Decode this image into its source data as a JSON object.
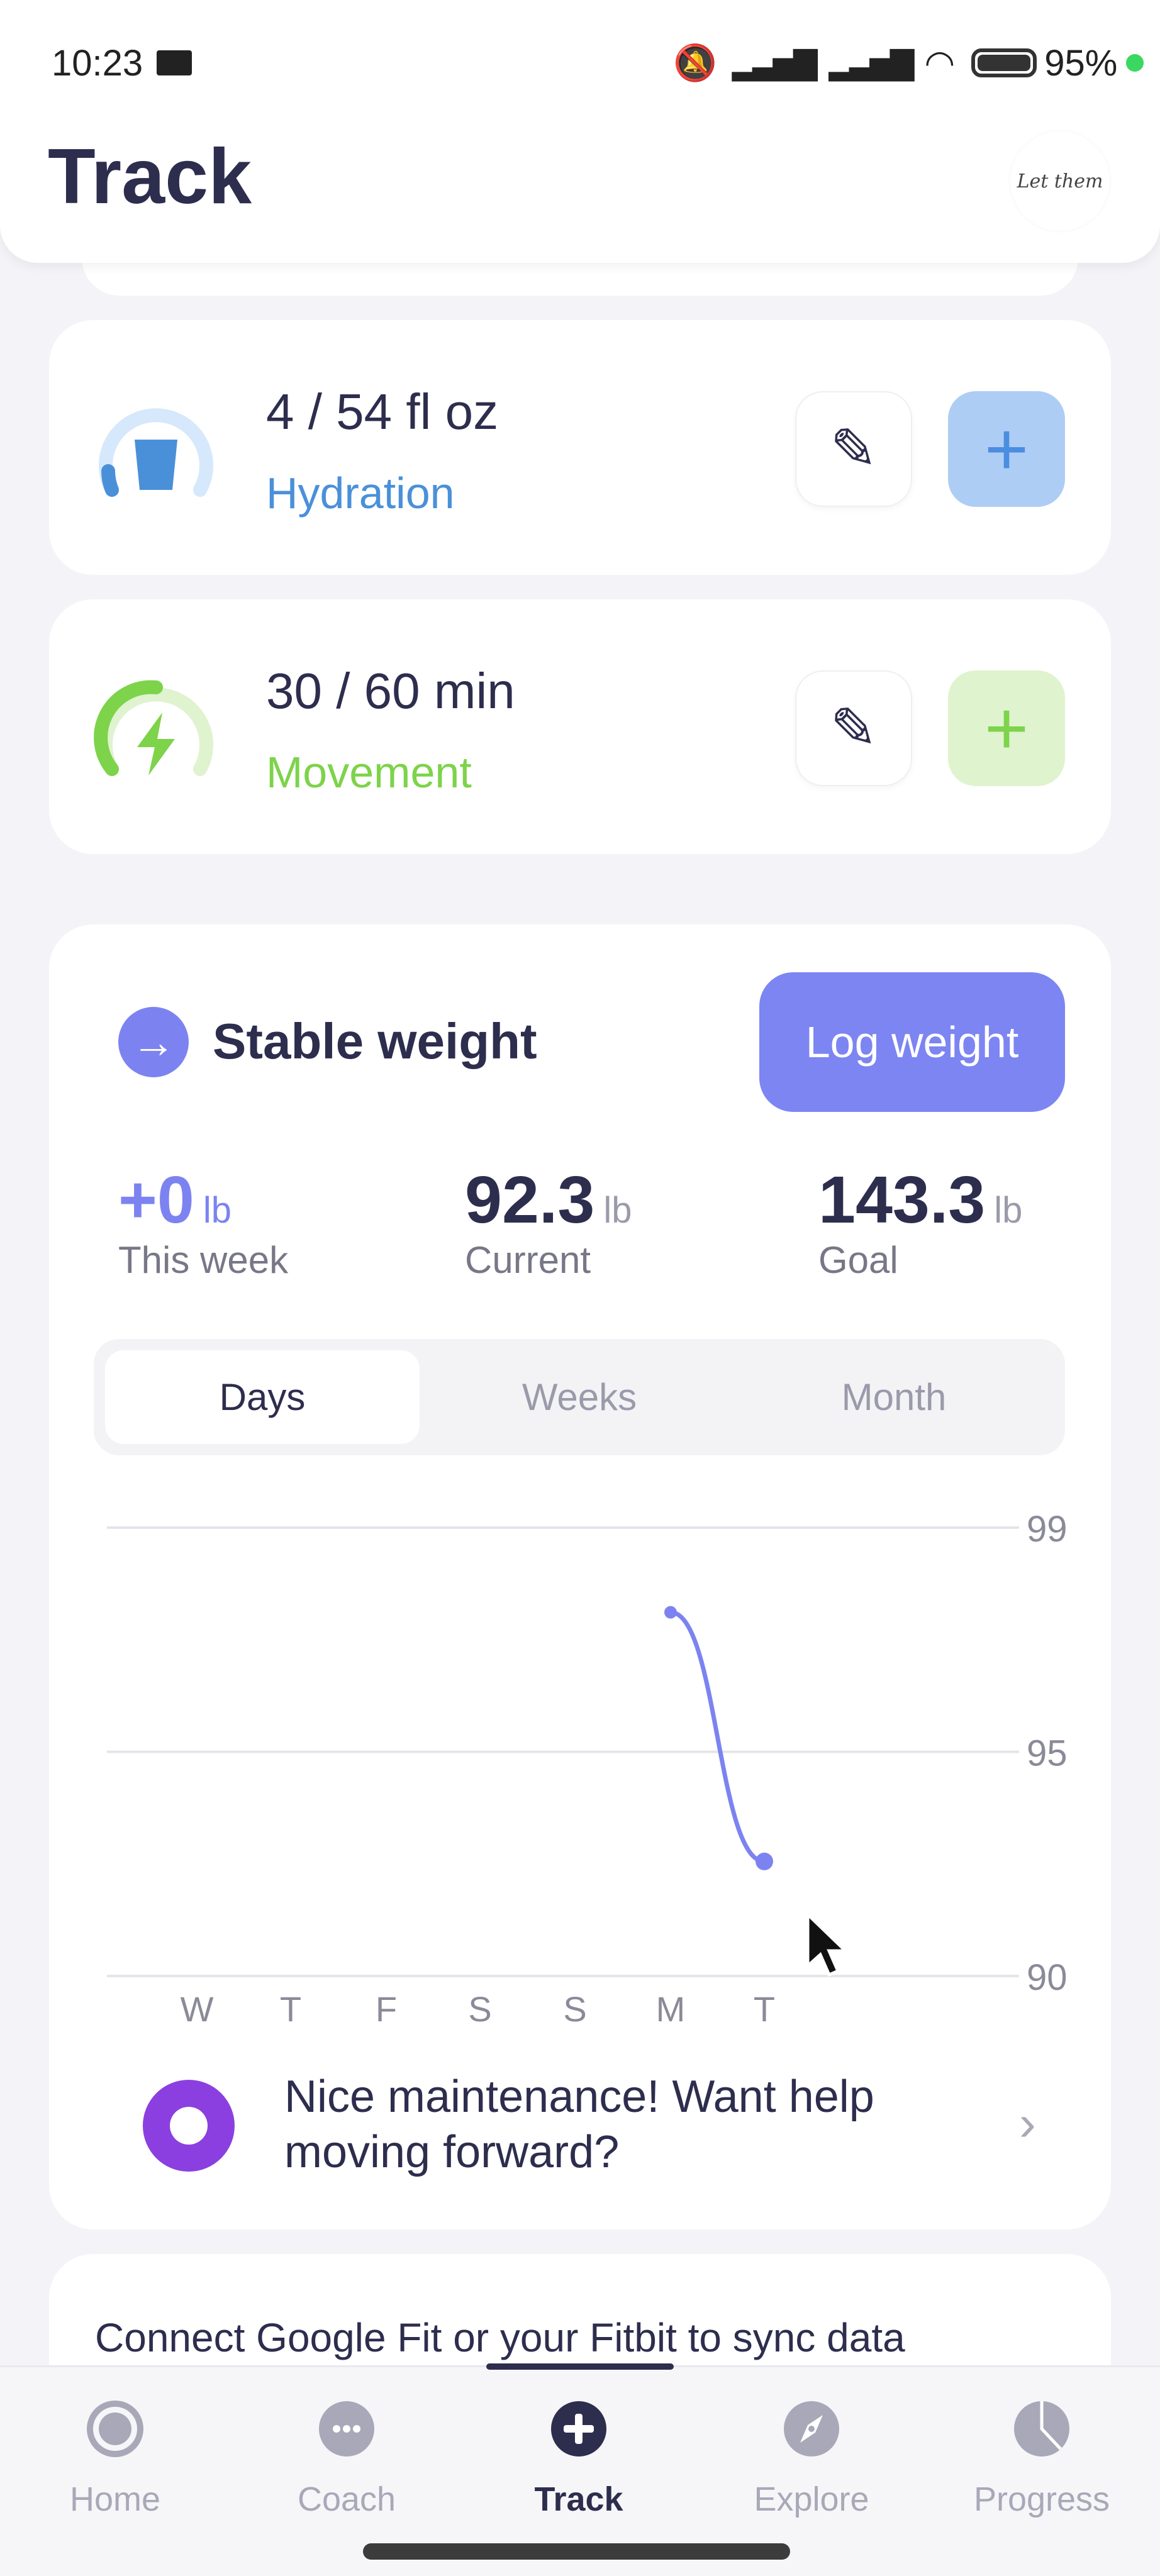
{
  "status_bar": {
    "time": "10:23",
    "battery": "95%"
  },
  "header": {
    "title": "Track",
    "avatar_text": "Let them"
  },
  "hydration": {
    "value": "4 / 54 fl oz",
    "label": "Hydration",
    "color": "#4a90d9"
  },
  "movement": {
    "value": "30 / 60 min",
    "label": "Movement",
    "color": "#7dd34a"
  },
  "weight": {
    "status": "Stable weight",
    "log_button": "Log weight",
    "stats": [
      {
        "value": "+0",
        "unit": "lb",
        "label": "This week"
      },
      {
        "value": "92.3",
        "unit": "lb",
        "label": "Current"
      },
      {
        "value": "143.3",
        "unit": "lb",
        "label": "Goal"
      }
    ],
    "tabs": [
      "Days",
      "Weeks",
      "Month"
    ],
    "selected_tab": "Days",
    "tip": {
      "line1": "Nice maintenance! Want help",
      "line2": "moving forward?"
    }
  },
  "chart_data": {
    "type": "line",
    "categories": [
      "W",
      "T",
      "F",
      "S",
      "S",
      "M",
      "T"
    ],
    "values": [
      null,
      null,
      null,
      null,
      null,
      97.3,
      92.3
    ],
    "ylim": [
      90,
      99
    ],
    "ytick_labels": [
      "99",
      "95",
      "90"
    ],
    "grid": true,
    "color": "#7c83f0"
  },
  "connect": {
    "text": "Connect Google Fit or your Fitbit to sync data"
  },
  "nav": {
    "items": [
      {
        "label": "Home",
        "icon": "home-icon"
      },
      {
        "label": "Coach",
        "icon": "chat-icon"
      },
      {
        "label": "Track",
        "icon": "plus-circle-icon"
      },
      {
        "label": "Explore",
        "icon": "compass-icon"
      },
      {
        "label": "Progress",
        "icon": "pie-chart-icon"
      }
    ],
    "active": "Track"
  }
}
